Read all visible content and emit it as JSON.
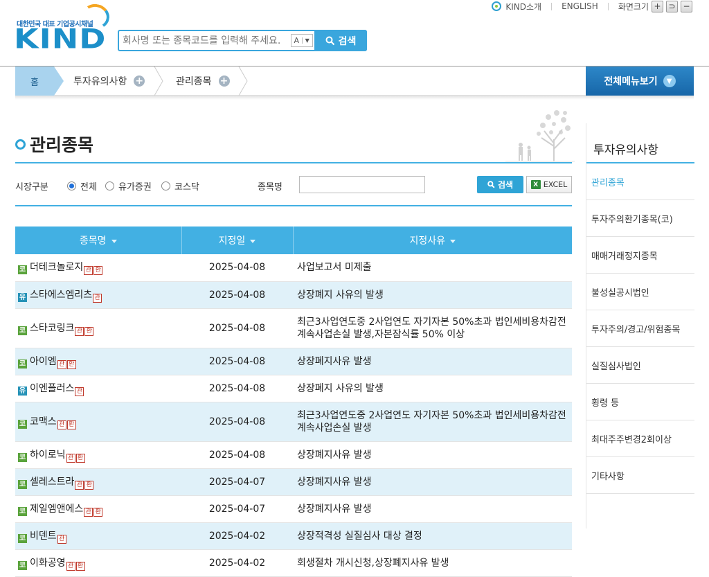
{
  "header": {
    "logo_tagline": "대한민국 대표 기업공시채널",
    "logo_text": "KIND",
    "util_about": "KIND소개",
    "util_english": "ENGLISH",
    "util_zoom": "화면크기",
    "zoom_in": "+",
    "zoom_reset": "⊃",
    "zoom_out": "−"
  },
  "search": {
    "placeholder": "회사명 또는 종목코드를 입력해 주세요.",
    "ak_label": "A",
    "ak_arrow": "▼",
    "button": "검색"
  },
  "nav": {
    "home": "홈",
    "crumbs": [
      "투자유의사항",
      "관리종목"
    ],
    "all_menu": "전체메뉴보기"
  },
  "page": {
    "title": "관리종목"
  },
  "filter": {
    "market_label": "시장구분",
    "options": [
      "전체",
      "유가증권",
      "코스닥"
    ],
    "selected": "전체",
    "name_label": "종목명",
    "name_value": "",
    "search_button": "검색",
    "excel_button": "EXCEL"
  },
  "table": {
    "headers": [
      "종목명",
      "지정일",
      "지정사유"
    ],
    "rows": [
      {
        "market": "코",
        "name": "더테크놀로지",
        "tags": [
          "관",
          "환"
        ],
        "date": "2025-04-08",
        "reason": "사업보고서 미제출"
      },
      {
        "market": "유",
        "name": "스타에스엠리츠",
        "tags": [
          "관"
        ],
        "date": "2025-04-08",
        "reason": "상장폐지 사유의 발생"
      },
      {
        "market": "코",
        "name": "스타코링크",
        "tags": [
          "관",
          "환"
        ],
        "date": "2025-04-08",
        "reason": "최근3사업연도중 2사업연도 자기자본 50%초과 법인세비용차감전계속사업손실 발생,자본잠식률 50% 이상"
      },
      {
        "market": "코",
        "name": "아이엠",
        "tags": [
          "관",
          "환"
        ],
        "date": "2025-04-08",
        "reason": "상장폐지사유 발생"
      },
      {
        "market": "유",
        "name": "이엔플러스",
        "tags": [
          "관"
        ],
        "date": "2025-04-08",
        "reason": "상장폐지 사유의 발생"
      },
      {
        "market": "코",
        "name": "코맥스",
        "tags": [
          "관",
          "환"
        ],
        "date": "2025-04-08",
        "reason": "최근3사업연도중 2사업연도 자기자본 50%초과 법인세비용차감전계속사업손실 발생"
      },
      {
        "market": "코",
        "name": "하이로닉",
        "tags": [
          "관",
          "환"
        ],
        "date": "2025-04-08",
        "reason": "상장폐지사유 발생"
      },
      {
        "market": "코",
        "name": "셀레스트라",
        "tags": [
          "관",
          "환"
        ],
        "date": "2025-04-07",
        "reason": "상장폐지사유 발생"
      },
      {
        "market": "코",
        "name": "제일엠앤에스",
        "tags": [
          "관",
          "환"
        ],
        "date": "2025-04-07",
        "reason": "상장폐지사유 발생"
      },
      {
        "market": "코",
        "name": "비덴트",
        "tags": [
          "관"
        ],
        "date": "2025-04-02",
        "reason": "상장적격성 실질심사 대상 결정"
      },
      {
        "market": "코",
        "name": "이화공영",
        "tags": [
          "관",
          "환"
        ],
        "date": "2025-04-02",
        "reason": "회생절차 개시신청,상장폐지사유 발생"
      }
    ]
  },
  "side": {
    "title": "투자유의사항",
    "items": [
      "관리종목",
      "투자주의환기종목(코)",
      "매매거래정지종목",
      "불성실공시법인",
      "투자주의/경고/위험종목",
      "실질심사법인",
      "횡령 등",
      "최대주주변경2회이상",
      "기타사항"
    ],
    "active": "관리종목"
  },
  "colors": {
    "accent": "#42b0e3",
    "nav_button": "#1f74b6",
    "kosdaq_mark": "#5aa33c",
    "kospi_mark": "#2592b7",
    "tag_red": "#c0392b"
  }
}
